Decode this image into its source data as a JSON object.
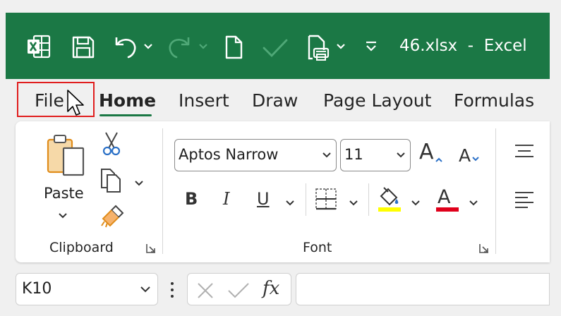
{
  "app": {
    "title": "46.xlsx  -  Excel",
    "accent": "#1b7845"
  },
  "quick_access": {
    "icons": [
      "excel-logo-icon",
      "save-icon",
      "undo-icon",
      "redo-icon",
      "new-file-icon",
      "checkmark-icon",
      "print-preview-icon",
      "customize-toolbar-icon"
    ]
  },
  "tabs": [
    {
      "label": "File"
    },
    {
      "label": "Home"
    },
    {
      "label": "Insert"
    },
    {
      "label": "Draw"
    },
    {
      "label": "Page Layout"
    },
    {
      "label": "Formulas"
    }
  ],
  "active_tab": "Home",
  "clipboard": {
    "paste_label": "Paste",
    "group_label": "Clipboard"
  },
  "font": {
    "font_name": "Aptos Narrow",
    "font_size": "11",
    "bold_label": "B",
    "italic_label": "I",
    "underline_label": "U",
    "grow_label": "A",
    "shrink_label": "A",
    "color_label": "A",
    "group_label": "Font",
    "highlight_color": "#ffff00",
    "font_color": "#e0001b"
  },
  "formula_bar": {
    "name_box": "K10",
    "fx_label": "fx",
    "formula_value": ""
  }
}
